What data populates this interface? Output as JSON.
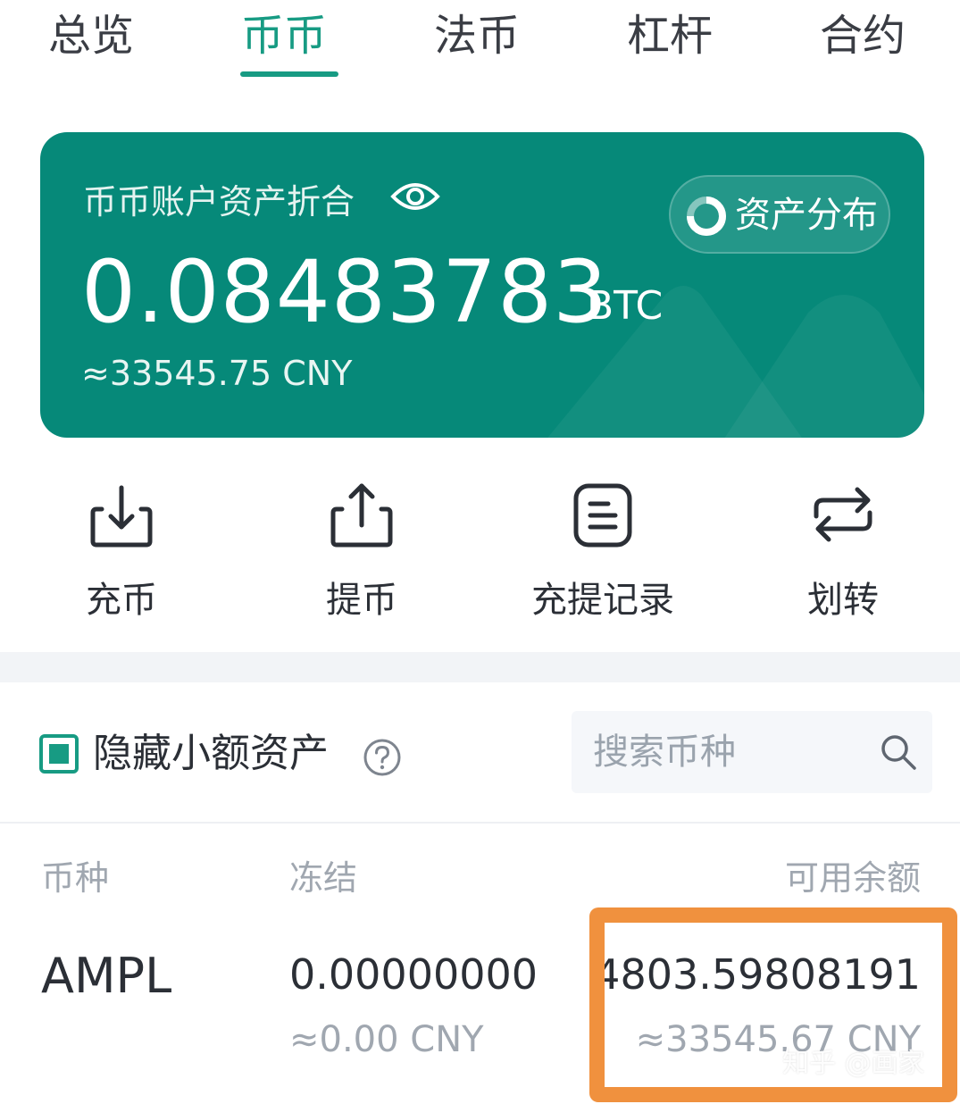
{
  "tabs": [
    {
      "label": "总览",
      "active": false
    },
    {
      "label": "币币",
      "active": true
    },
    {
      "label": "法币",
      "active": false
    },
    {
      "label": "杠杆",
      "active": false
    },
    {
      "label": "合约",
      "active": false
    }
  ],
  "card": {
    "title": "币币账户资产折合",
    "eye_icon": "eye-icon",
    "distribution_label": "资产分布",
    "distribution_icon": "donut-chart-icon",
    "balance": "0.08483783",
    "unit": "BTC",
    "cny": "≈33545.75 CNY"
  },
  "actions": [
    {
      "label": "充币",
      "icon": "deposit-icon"
    },
    {
      "label": "提币",
      "icon": "withdraw-icon"
    },
    {
      "label": "充提记录",
      "icon": "records-icon"
    },
    {
      "label": "划转",
      "icon": "transfer-icon"
    }
  ],
  "filter": {
    "hide_small_label": "隐藏小额资产",
    "hide_small_checked": true,
    "help_icon": "question-icon",
    "search_placeholder": "搜索币种",
    "search_value": ""
  },
  "table": {
    "headers": {
      "coin": "币种",
      "frozen": "冻结",
      "available": "可用余额"
    },
    "rows": [
      {
        "coin": "AMPL",
        "frozen": "0.00000000",
        "frozen_cny": "≈0.00 CNY",
        "available": "4803.59808191",
        "available_cny": "≈33545.67 CNY"
      }
    ]
  },
  "watermark": "知乎 @画家",
  "colors": {
    "accent": "#179b83",
    "card": "#068979",
    "highlight": "#f0913e"
  }
}
